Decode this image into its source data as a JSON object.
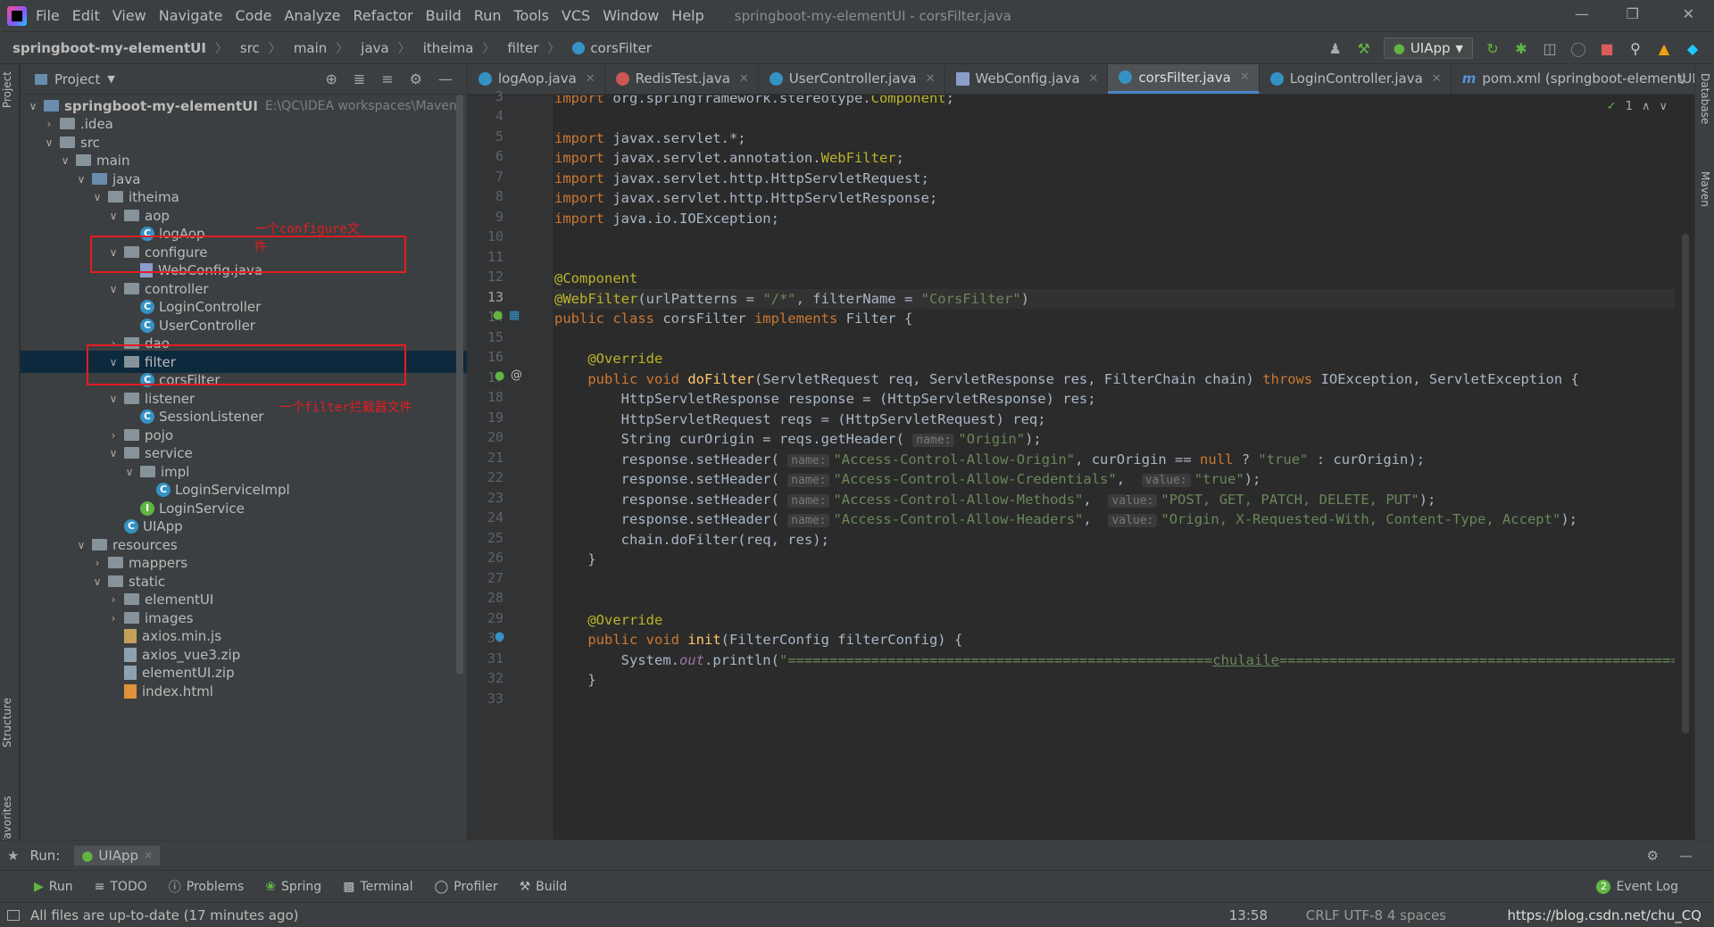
{
  "menu": {
    "items": [
      "File",
      "Edit",
      "View",
      "Navigate",
      "Code",
      "Analyze",
      "Refactor",
      "Build",
      "Run",
      "Tools",
      "VCS",
      "Window",
      "Help"
    ],
    "title": "springboot-my-elementUI - corsFilter.java"
  },
  "nav": {
    "crumbs": [
      "springboot-my-elementUI",
      "src",
      "main",
      "java",
      "itheima",
      "filter",
      "corsFilter"
    ],
    "run_config": "UIApp"
  },
  "project": {
    "header": "Project",
    "root_name": "springboot-my-elementUI",
    "root_path": "E:\\QC\\IDEA workspaces\\Maven",
    "items": [
      ".idea",
      "src",
      "main",
      "java",
      "itheima",
      "aop",
      "logAop",
      "configure",
      "WebConfig.java",
      "controller",
      "LoginController",
      "UserController",
      "dao",
      "filter",
      "corsFilter",
      "listener",
      "SessionListener",
      "pojo",
      "service",
      "impl",
      "LoginServiceImpl",
      "LoginService",
      "UIApp",
      "resources",
      "mappers",
      "static",
      "elementUI",
      "images",
      "axios.min.js",
      "axios_vue3.zip",
      "elementUI.zip",
      "index.html"
    ],
    "note_configure": "一个configure文件",
    "note_filter": "一个filter拦截器文件"
  },
  "tabs": [
    "logAop.java",
    "RedisTest.java",
    "UserController.java",
    "WebConfig.java",
    "corsFilter.java",
    "LoginController.java",
    "pom.xml (springboot-elementUI"
  ],
  "editor": {
    "line_numbers": [
      "3",
      "4",
      "5",
      "6",
      "7",
      "8",
      "9",
      "10",
      "11",
      "12",
      "13",
      "14",
      "15",
      "16",
      "17",
      "18",
      "19",
      "20",
      "21",
      "22",
      "23",
      "24",
      "25",
      "26",
      "27",
      "28",
      "29",
      "30",
      "31",
      "32",
      "33"
    ],
    "problems_count": "1",
    "hints": {
      "name": "name:",
      "value": "value:"
    }
  },
  "run": {
    "label": "Run:",
    "config": "UIApp"
  },
  "bottom_tabs": [
    "Run",
    "TODO",
    "Problems",
    "Spring",
    "Terminal",
    "Profiler",
    "Build"
  ],
  "event_log": "Event Log",
  "event_count": "2",
  "status": {
    "message": "All files are up-to-date (17 minutes ago)",
    "time": "13:58",
    "encoding": "CRLF UTF-8 4 spaces",
    "watermark": "https://blog.csdn.net/chu_CQ"
  },
  "side_tabs": {
    "project": "Project",
    "structure": "Structure",
    "favorites": "Favorites",
    "database": "Database",
    "maven": "Maven"
  }
}
